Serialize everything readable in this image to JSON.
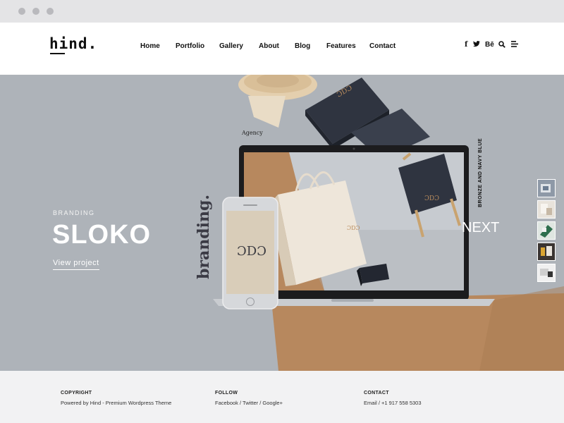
{
  "header": {
    "logo": "hind.",
    "nav": [
      "Home",
      "Portfolio",
      "Gallery",
      "About",
      "Blog",
      "Features",
      "Contact"
    ],
    "social_icons": [
      "facebook-icon",
      "twitter-icon",
      "behance-icon",
      "search-icon",
      "menu-icon"
    ],
    "social_glyphs": [
      "f",
      "🐦",
      "Bē",
      "⌕",
      "≡"
    ]
  },
  "hero": {
    "kicker": "BRANDING",
    "title": "SLOKO",
    "link": "View project",
    "next": "NEXT",
    "agency_label": "Agency",
    "vertical_brand": "branding.",
    "vertical_note": "BRONZE AND NAVY BLUE",
    "thumbnail_count": 5
  },
  "footer": {
    "copyright_heading": "COPYRIGHT",
    "copyright_text": "Powered by Hind - Premium Wordpress Theme",
    "follow_heading": "FOLLOW",
    "follow_text": "Facebook / Twitter / Google+",
    "contact_heading": "CONTACT",
    "contact_text": "Email / +1 917 558 5303"
  },
  "colors": {
    "hero_bg": "#aeb3b9",
    "accent_copper": "#b7885e",
    "navy": "#2f3440",
    "footer_bg": "#f2f2f3"
  }
}
